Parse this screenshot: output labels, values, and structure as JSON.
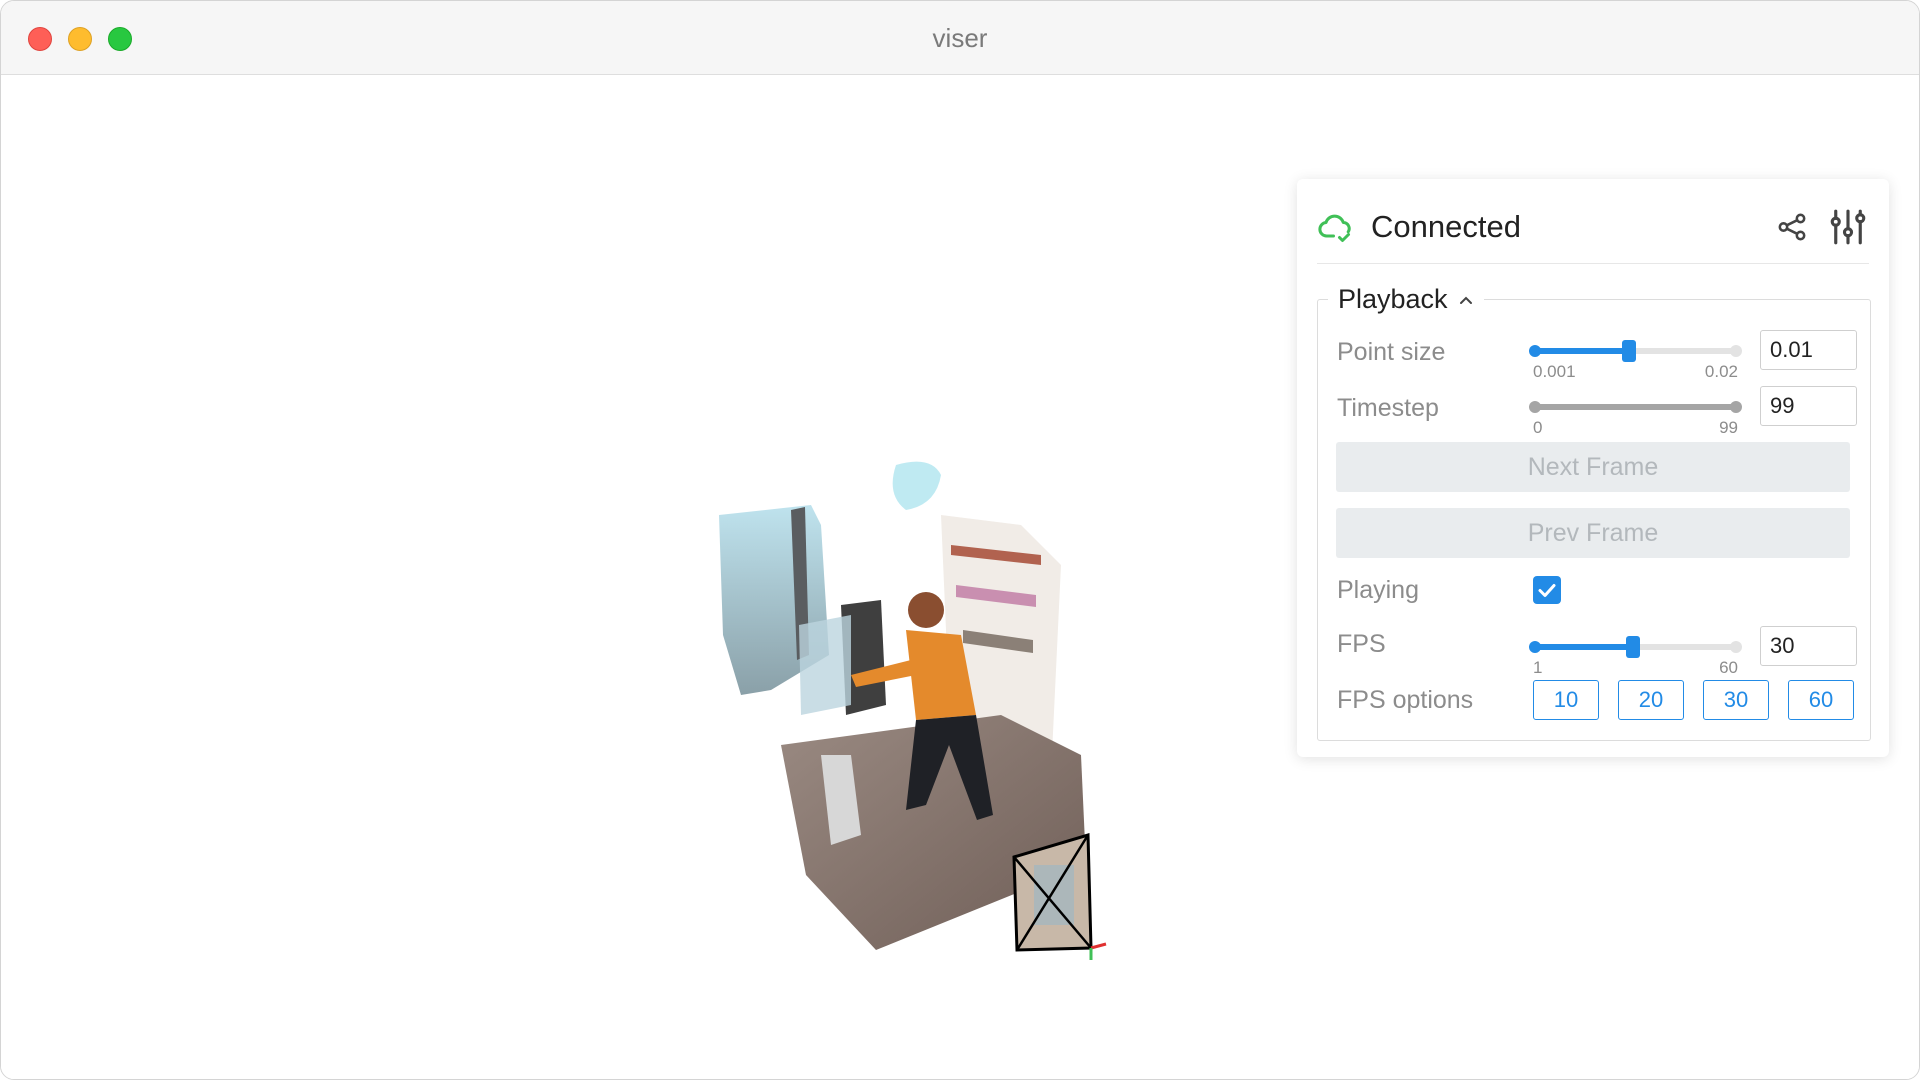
{
  "window": {
    "title": "viser"
  },
  "panel": {
    "status_text": "Connected",
    "status_color": "#40c057",
    "accent_color": "#228be6",
    "icons": {
      "status": "cloud-check-icon",
      "share": "share-icon",
      "settings": "sliders-icon"
    },
    "folder": {
      "label": "Playback",
      "expanded": true,
      "controls": {
        "point_size": {
          "label": "Point size",
          "min_label": "0.001",
          "max_label": "0.02",
          "value": "0.01",
          "fraction": 0.47
        },
        "timestep": {
          "label": "Timestep",
          "min_label": "0",
          "max_label": "99",
          "value": "99",
          "fraction": 1.0,
          "disabled": true
        },
        "next_frame": {
          "label": "Next Frame",
          "disabled": true
        },
        "prev_frame": {
          "label": "Prev Frame",
          "disabled": true
        },
        "playing": {
          "label": "Playing",
          "checked": true
        },
        "fps": {
          "label": "FPS",
          "min_label": "1",
          "max_label": "60",
          "value": "30",
          "fraction": 0.49
        },
        "fps_options": {
          "label": "FPS options",
          "options": [
            "10",
            "20",
            "30",
            "60"
          ]
        }
      }
    }
  }
}
